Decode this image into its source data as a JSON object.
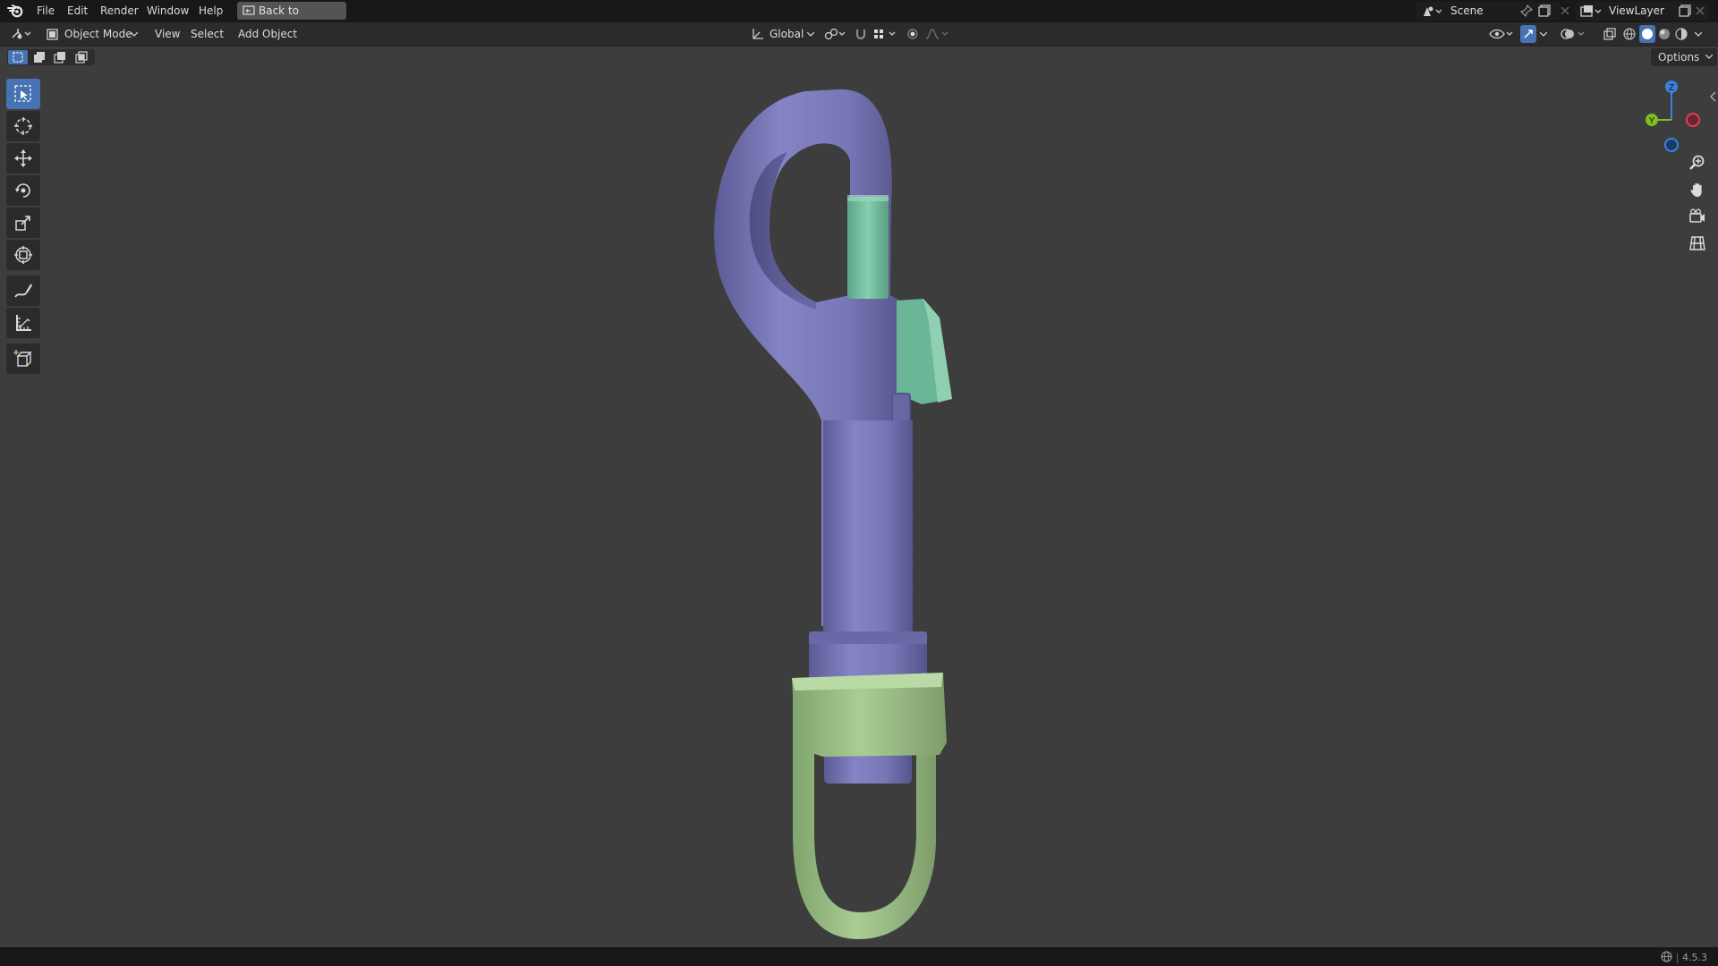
{
  "menu": {
    "file": "File",
    "edit": "Edit",
    "render": "Render",
    "window": "Window",
    "help": "Help",
    "back_to_previous": "Back to Previous"
  },
  "scene": {
    "label": "Scene",
    "view_layer": "ViewLayer"
  },
  "header": {
    "mode": "Object Mode",
    "view": "View",
    "select": "Select",
    "add": "Add",
    "object": "Object",
    "orientation": "Global"
  },
  "gizmo": {
    "z": "Z",
    "y": "Y"
  },
  "options": "Options",
  "status": {
    "version": "4.5.3"
  },
  "colors": {
    "accent": "#4772b3",
    "hook_body": "#7a7ab8",
    "gate": "#6fbf9d",
    "swivel": "#9bc086"
  },
  "icons": {
    "tools": [
      "select-box-icon",
      "cursor-icon",
      "move-icon",
      "rotate-icon",
      "scale-icon",
      "transform-icon",
      "annotate-icon",
      "measure-icon",
      "add-cube-icon"
    ],
    "nav": [
      "zoom-icon",
      "pan-hand-icon",
      "camera-icon",
      "perspective-grid-icon"
    ]
  }
}
